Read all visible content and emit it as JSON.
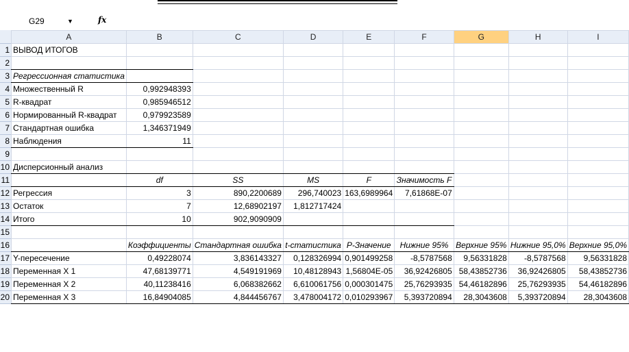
{
  "namebox": {
    "cell": "G29",
    "arrow": "▼",
    "fx": "fx"
  },
  "columns": [
    "A",
    "B",
    "C",
    "D",
    "E",
    "F",
    "G",
    "H",
    "I"
  ],
  "rows": [
    "1",
    "2",
    "3",
    "4",
    "5",
    "6",
    "7",
    "8",
    "9",
    "10",
    "11",
    "12",
    "13",
    "14",
    "15",
    "16",
    "17",
    "18",
    "19",
    "20"
  ],
  "sheet": {
    "title": "ВЫВОД ИТОГОВ",
    "regstat": {
      "header": "Регрессионная статистика",
      "items": [
        {
          "label": "Множественный R",
          "value": "0,992948393"
        },
        {
          "label": "R-квадрат",
          "value": "0,985946512"
        },
        {
          "label": "Нормированный R-квадрат",
          "value": "0,979923589"
        },
        {
          "label": "Стандартная ошибка",
          "value": "1,346371949"
        },
        {
          "label": "Наблюдения",
          "value": "11"
        }
      ]
    },
    "anova": {
      "title": "Дисперсионный анализ",
      "headers": [
        "df",
        "SS",
        "MS",
        "F",
        "Значимость F"
      ],
      "rows": [
        {
          "label": "Регрессия",
          "df": "3",
          "ss": "890,2200689",
          "ms": "296,740023",
          "f": "163,6989964",
          "sig": "7,61868E-07"
        },
        {
          "label": "Остаток",
          "df": "7",
          "ss": "12,68902197",
          "ms": "1,812717424",
          "f": "",
          "sig": ""
        },
        {
          "label": "Итого",
          "df": "10",
          "ss": "902,9090909",
          "ms": "",
          "f": "",
          "sig": ""
        }
      ]
    },
    "coef": {
      "headers": [
        "Коэффициенты",
        "Стандартная ошибка",
        "t-статистика",
        "P-Значение",
        "Нижние 95%",
        "Верхние 95%",
        "Нижние 95,0%",
        "Верхние 95,0%"
      ],
      "rows": [
        {
          "label": "Y-пересечение",
          "v": [
            "0,49228074",
            "3,836143327",
            "0,128326994",
            "0,901499258",
            "-8,5787568",
            "9,56331828",
            "-8,5787568",
            "9,56331828"
          ]
        },
        {
          "label": "Переменная X 1",
          "v": [
            "47,68139771",
            "4,549191969",
            "10,48128943",
            "1,56804E-05",
            "36,92426805",
            "58,43852736",
            "36,92426805",
            "58,43852736"
          ]
        },
        {
          "label": "Переменная X 2",
          "v": [
            "40,11238416",
            "6,068382662",
            "6,610061756",
            "0,000301475",
            "25,76293935",
            "54,46182896",
            "25,76293935",
            "54,46182896"
          ]
        },
        {
          "label": "Переменная X 3",
          "v": [
            "16,84904085",
            "4,844456767",
            "3,478004172",
            "0,010293967",
            "5,393720894",
            "28,3043608",
            "5,393720894",
            "28,3043608"
          ]
        }
      ]
    }
  }
}
